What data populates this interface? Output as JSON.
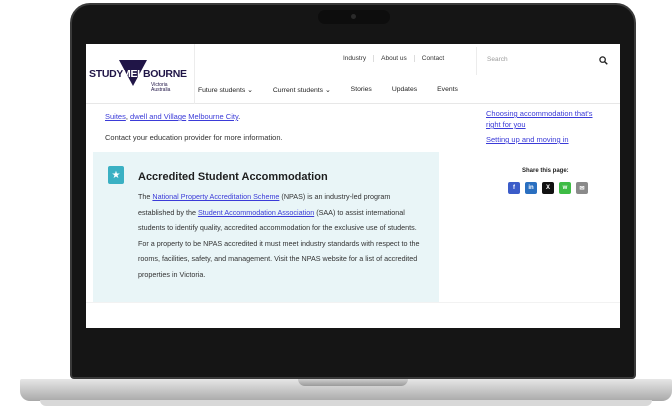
{
  "header": {
    "logo": {
      "word_left": "STUDY",
      "word_mid": "MEL",
      "word_right": "BOURNE",
      "sub1": "Victoria",
      "sub2": "Australia"
    },
    "util_nav": [
      "Industry",
      "About us",
      "Contact"
    ],
    "search_placeholder": "Search",
    "main_nav": [
      "Future students ⌄",
      "Current students ⌄",
      "Stories",
      "Updates",
      "Events"
    ]
  },
  "content": {
    "intro": {
      "link1": "Suites",
      "sep": ", ",
      "link2": "dwell and Village",
      "space": " ",
      "link3": "Melbourne City",
      "end": "."
    },
    "contact_line": "Contact your education provider for more information.",
    "callout": {
      "title": "Accredited Student Accommodation",
      "body_1": "The ",
      "link_npas": "National Property Accreditation Scheme",
      "body_2": " (NPAS) is an industry-led program established by the ",
      "link_saa": "Student Accommodation Association",
      "body_3": " (SAA) to assist international students to identify quality, accredited accommodation for the exclusive use of students. For a property to be NPAS accredited it must meet industry standards with respect to the rooms, facilities, safety, and management. Visit the NPAS website for a list of accredited properties in Victoria."
    }
  },
  "sidebar": {
    "links": [
      "Choosing accommodation that's right for you",
      "Setting up and moving in"
    ],
    "share_label": "Share this page:",
    "share_buttons": [
      {
        "glyph": "f",
        "color": "#3b5cc9"
      },
      {
        "glyph": "in",
        "color": "#2a6fc0"
      },
      {
        "glyph": "X",
        "color": "#111111"
      },
      {
        "glyph": "w",
        "color": "#3ebc45"
      },
      {
        "glyph": "✉",
        "color": "#8a8a8a"
      }
    ]
  }
}
